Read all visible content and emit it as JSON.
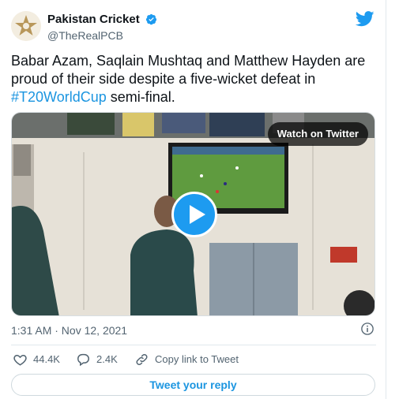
{
  "tweet": {
    "author": {
      "name": "Pakistan Cricket",
      "handle": "@TheRealPCB",
      "verified": true,
      "avatar_icon": "pcb-star-logo"
    },
    "text_prefix": "Babar Azam, Saqlain Mushtaq and Matthew Hayden are proud of their side despite a five-wicket defeat in ",
    "hashtag": "#T20WorldCup",
    "text_suffix": " semi-final.",
    "media": {
      "watch_label": "Watch on Twitter",
      "play_icon": "play-icon"
    },
    "timestamp": "1:31 AM · Nov 12, 2021",
    "actions": {
      "likes": "44.4K",
      "replies": "2.4K",
      "copy_link": "Copy link to Tweet"
    },
    "reply_button": "Tweet your reply"
  },
  "colors": {
    "accent": "#1d9bf0",
    "link": "#1b95e0",
    "like": "#536471"
  }
}
